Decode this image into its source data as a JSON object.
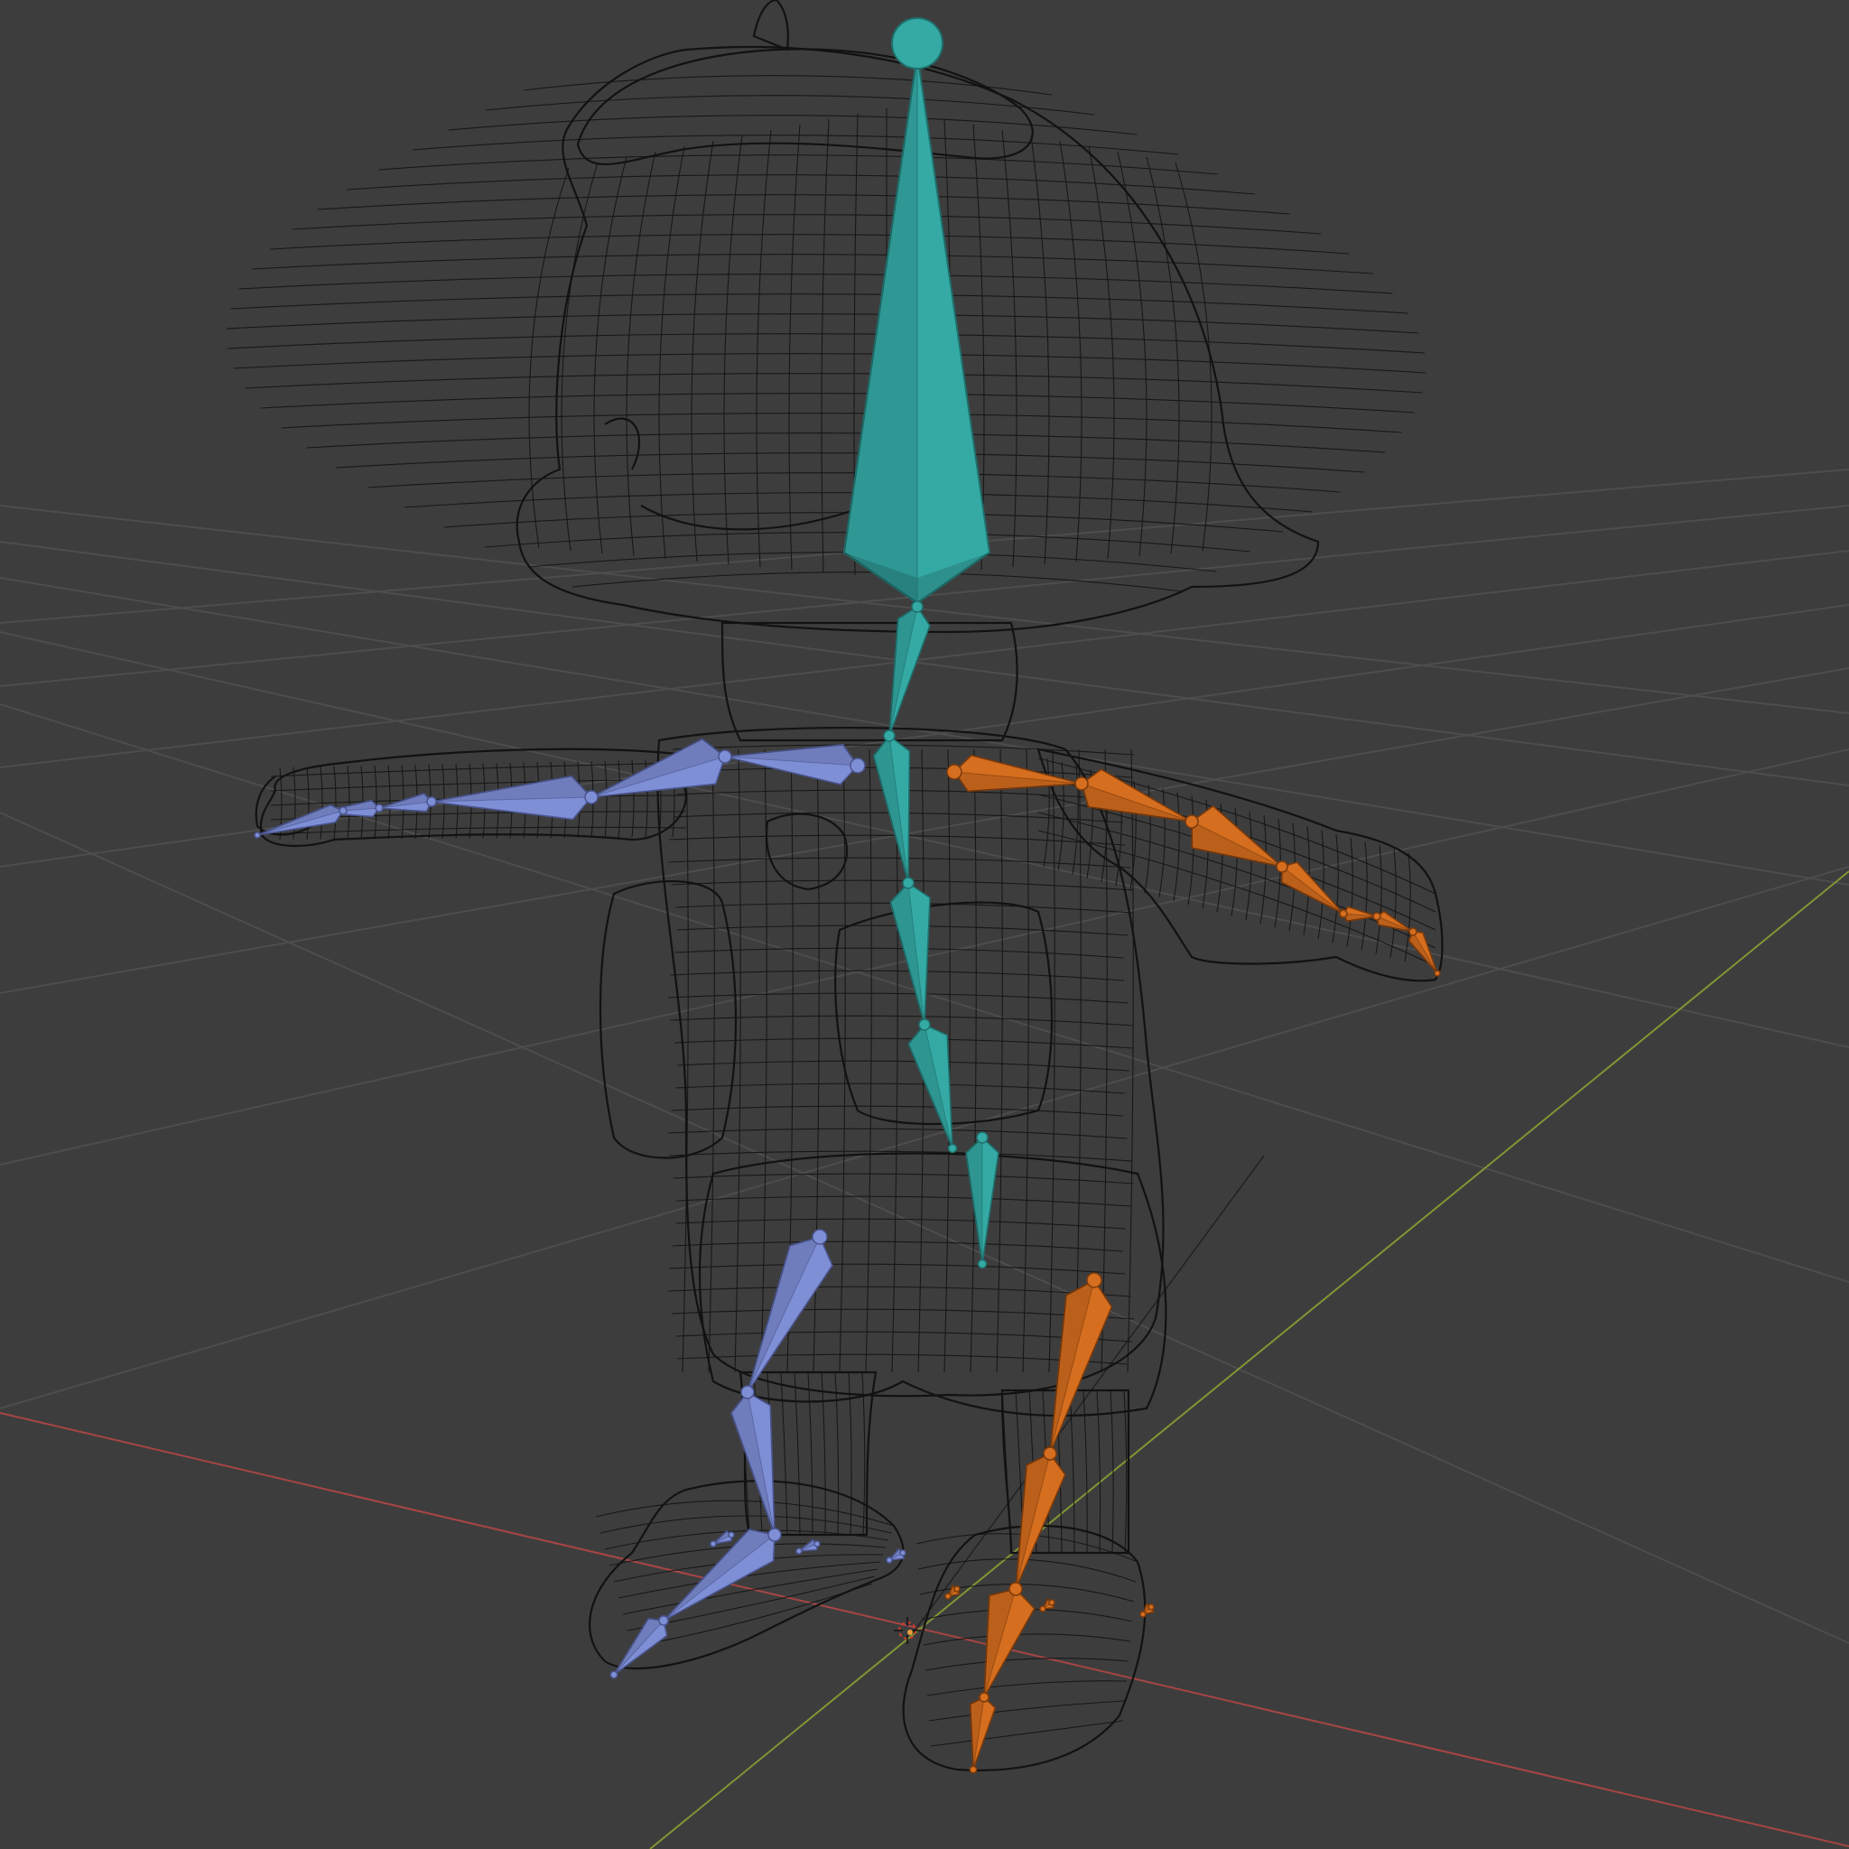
{
  "viewport": {
    "background": "#3d3d3d",
    "grid_color": "#4d4d4d",
    "x_axis_color": "#b84a4a",
    "y_axis_color": "#8fa63a",
    "wireframe_color": "#111111"
  },
  "armature": {
    "center_color": "#35aaa5",
    "center_edge": "#1f6f6c",
    "right_color": "#7f8fd6",
    "right_edge": "#4a558f",
    "left_color": "#d56e1f",
    "left_edge": "#7a3a0c",
    "bone_groups": [
      "spine-head",
      "arm-right",
      "arm-left",
      "leg-right",
      "leg-left"
    ]
  },
  "gizmos": {
    "cursor_icon": "3d-cursor-icon",
    "origin_icon": "object-origin-icon"
  }
}
